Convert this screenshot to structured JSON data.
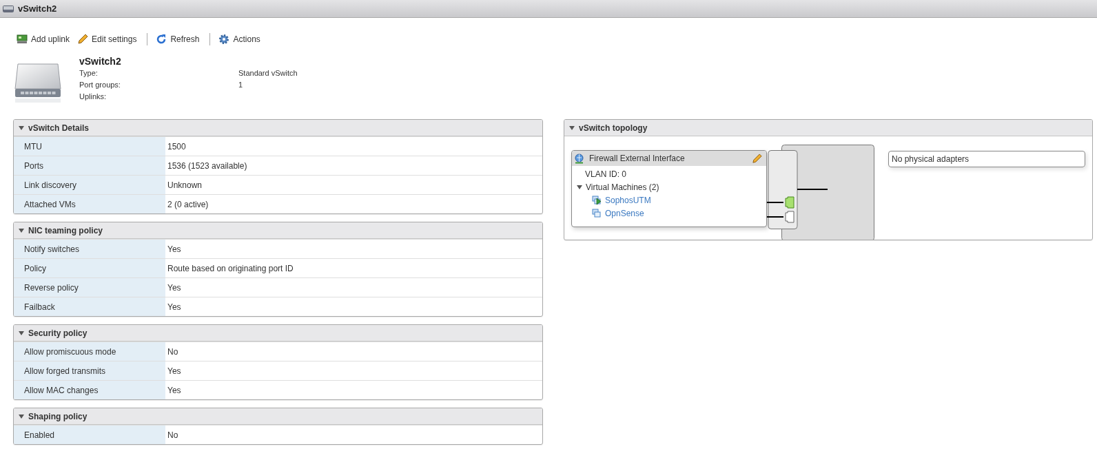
{
  "window": {
    "title": "vSwitch2"
  },
  "toolbar": [
    {
      "kind": "uplink",
      "label": "Add uplink"
    },
    {
      "kind": "edit",
      "label": "Edit settings"
    },
    {
      "kind": "refresh",
      "label": "Refresh"
    },
    {
      "kind": "actions",
      "label": "Actions"
    }
  ],
  "summary": {
    "name": "vSwitch2",
    "fields": [
      {
        "label": "Type:",
        "value": "Standard vSwitch"
      },
      {
        "label": "Port groups:",
        "value": "1"
      },
      {
        "label": "Uplinks:"
      }
    ]
  },
  "panels": [
    {
      "title": "vSwitch Details",
      "expanded": true,
      "rows": [
        {
          "label": "MTU",
          "value": "1500"
        },
        {
          "label": "Ports",
          "value": "1536 (1523 available)"
        },
        {
          "label": "Link discovery",
          "value": "Unknown"
        },
        {
          "label": "Attached VMs",
          "value": "2 (0 active)"
        }
      ]
    },
    {
      "title": "NIC teaming policy",
      "expanded": true,
      "rows": [
        {
          "label": "Notify switches",
          "value": "Yes"
        },
        {
          "label": "Policy",
          "value": "Route based on originating port ID"
        },
        {
          "label": "Reverse policy",
          "value": "Yes"
        },
        {
          "label": "Failback",
          "value": "Yes"
        }
      ]
    },
    {
      "title": "Security policy",
      "expanded": true,
      "rows": [
        {
          "label": "Allow promiscuous mode",
          "value": "No"
        },
        {
          "label": "Allow forged transmits",
          "value": "Yes"
        },
        {
          "label": "Allow MAC changes",
          "value": "Yes"
        }
      ]
    },
    {
      "title": "Shaping policy",
      "expanded": true,
      "rows": [
        {
          "label": "Enabled",
          "value": "No"
        }
      ]
    }
  ],
  "topology": {
    "title": "vSwitch topology",
    "expanded": true,
    "port_group": {
      "name": "Firewall External Interface",
      "vlan": "VLAN ID: 0",
      "vms_label": "Virtual Machines (2)",
      "vms_expanded": true,
      "vms": [
        {
          "name": "SophosUTM",
          "on": true
        },
        {
          "name": "OpnSense",
          "on": false
        }
      ]
    },
    "adapters": "No physical adapters"
  }
}
